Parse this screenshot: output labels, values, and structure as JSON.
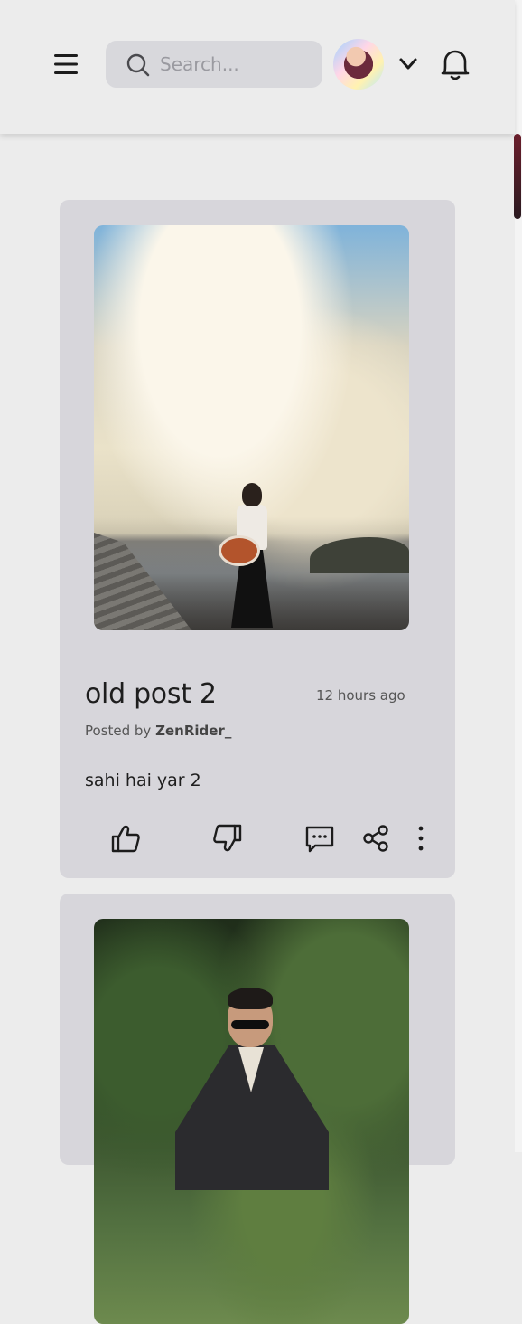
{
  "header": {
    "menu_icon": "hamburger-menu-icon",
    "search": {
      "placeholder": "Search...",
      "value": "",
      "icon": "search-icon"
    },
    "avatar_icon": "user-avatar",
    "dropdown_icon": "chevron-down-icon",
    "notifications_icon": "bell-icon"
  },
  "posts": [
    {
      "title": "old post 2",
      "time": "12 hours ago",
      "posted_by_label": "Posted by",
      "author": "ZenRider_",
      "body": "sahi hai yar 2",
      "actions": [
        "thumbs-up-icon",
        "thumbs-down-icon",
        "comment-icon",
        "share-icon",
        "more-vertical-icon"
      ]
    },
    {
      "title": "",
      "time": "",
      "author": "",
      "body": ""
    }
  ],
  "colors": {
    "background": "#ececec",
    "card": "#d7d6db",
    "search_bg": "#d8d8dc",
    "scroll_thumb": "#6b1e2c"
  }
}
